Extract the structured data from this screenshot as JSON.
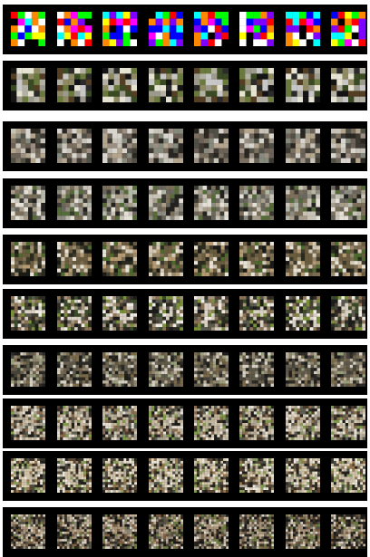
{
  "figure": {
    "rows": [
      {
        "cells_per_side": 5,
        "palette": [
          "#ff0000",
          "#00ff00",
          "#0000ff",
          "#ffff00",
          "#ff00ff",
          "#00ffff",
          "#ffffff",
          "#ff8800",
          "#7f00ff",
          "#000000"
        ]
      },
      {
        "cells_per_side": 6,
        "palette": [
          "#e6e3d2",
          "#8f8a63",
          "#3a4a22",
          "#b3b0a4",
          "#141414",
          "#6a7a3d",
          "#c7c7c7",
          "#553f24",
          "#2b2b2b",
          "#9c9a8c"
        ]
      },
      {
        "cells_per_side": 7,
        "palette": [
          "#9b8e82",
          "#6d6257",
          "#c8c3b8",
          "#3e3a33",
          "#858a7c",
          "#b4a68e",
          "#515046",
          "#d8d5cf",
          "#2a2722",
          "#7b7060"
        ]
      },
      {
        "cells_per_side": 8,
        "palette": [
          "#c9c3b7",
          "#6a675e",
          "#8d8a7f",
          "#3b3a33",
          "#e4e0d6",
          "#556b3a",
          "#a79d8a",
          "#232220",
          "#7c6f5a",
          "#b2b7a8"
        ]
      },
      {
        "cells_per_side": 9,
        "palette": [
          "#6a5c3e",
          "#2a2a1e",
          "#9a8a6c",
          "#d2c8b4",
          "#4d6a2e",
          "#1a1a16",
          "#b59a72",
          "#e8e2d6",
          "#7d6d52",
          "#3d3a2c"
        ]
      },
      {
        "cells_per_side": 10,
        "palette": [
          "#d8d0c2",
          "#4a3f33",
          "#7a8f3a",
          "#1c1c1a",
          "#a4947a",
          "#5b5a4e",
          "#efeae2",
          "#3a4a2a",
          "#8b7358",
          "#2e2a24"
        ]
      },
      {
        "cells_per_side": 11,
        "palette": [
          "#5f5a4a",
          "#8f8470",
          "#2d2b26",
          "#b8ad98",
          "#7a6a4a",
          "#d6d0c4",
          "#46433a",
          "#9aa07e",
          "#1f1e1b",
          "#6d6252"
        ]
      },
      {
        "cells_per_side": 12,
        "palette": [
          "#c2b49a",
          "#4b3b2c",
          "#7e9a4a",
          "#1e1d1b",
          "#e6e0d4",
          "#8a6d4e",
          "#5c5f52",
          "#a9a292",
          "#2f2a23",
          "#d1c6b0"
        ]
      },
      {
        "cells_per_side": 13,
        "palette": [
          "#cfc2a8",
          "#5a4634",
          "#899d5a",
          "#22201c",
          "#ece7dd",
          "#95784f",
          "#4d4f45",
          "#b5ad9c",
          "#352e25",
          "#e0d3b8"
        ]
      },
      {
        "cells_per_side": 14,
        "palette": [
          "#a8927a",
          "#3c3228",
          "#6f7d45",
          "#1a1917",
          "#d9d1c3",
          "#7d6043",
          "#575447",
          "#c4b69c",
          "#2a241e",
          "#8e8676"
        ]
      }
    ]
  }
}
